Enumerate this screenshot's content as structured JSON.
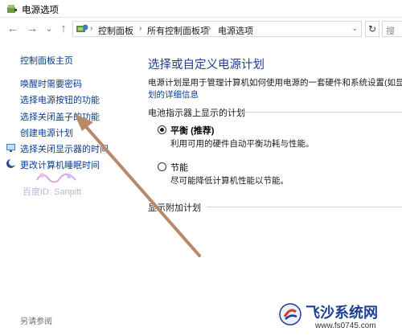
{
  "window": {
    "title": "电源选项",
    "icon": "power-options-icon"
  },
  "navbar": {
    "back_icon": "←",
    "forward_icon": "→",
    "recent_icon": "⌄",
    "up_icon": "↑",
    "breadcrumbs": [
      "控制面板",
      "所有控制面板项",
      "电源选项"
    ],
    "separator": "›",
    "dropdown_icon": "⌄",
    "refresh_icon": "↻",
    "search_placeholder": "搜"
  },
  "sidebar": {
    "home_link": "控制面板主页",
    "links": [
      "唤醒时需要密码",
      "选择电源按钮的功能",
      "选择关闭盖子的功能",
      "创建电源计划",
      "选择关闭显示器的时间",
      "更改计算机睡眠时间"
    ],
    "see_also": "另请参阅"
  },
  "main": {
    "title": "选择或自定义电源计划",
    "description": "电源计划是用于管理计算机如何使用电源的一套硬件和系统设置(如显示",
    "description_link": "划的详细信息",
    "battery_group": "电池指示器上显示的计划",
    "plans": [
      {
        "name": "平衡",
        "tag": "(推荐)",
        "desc": "利用可用的硬件自动平衡功耗与性能。",
        "checked": true
      },
      {
        "name": "节能",
        "tag": "",
        "desc": "尽可能降低计算机性能以节能。",
        "checked": false
      }
    ],
    "extra_group": "显示附加计划"
  },
  "watermarks": {
    "baidu": "百度ID: Sanpitt",
    "site_name": "飞沙系统网",
    "site_url": "www.fs0745.com"
  },
  "colors": {
    "link": "#0b3c8c",
    "title": "#1e3f91",
    "arrow": "#b98a6a"
  }
}
